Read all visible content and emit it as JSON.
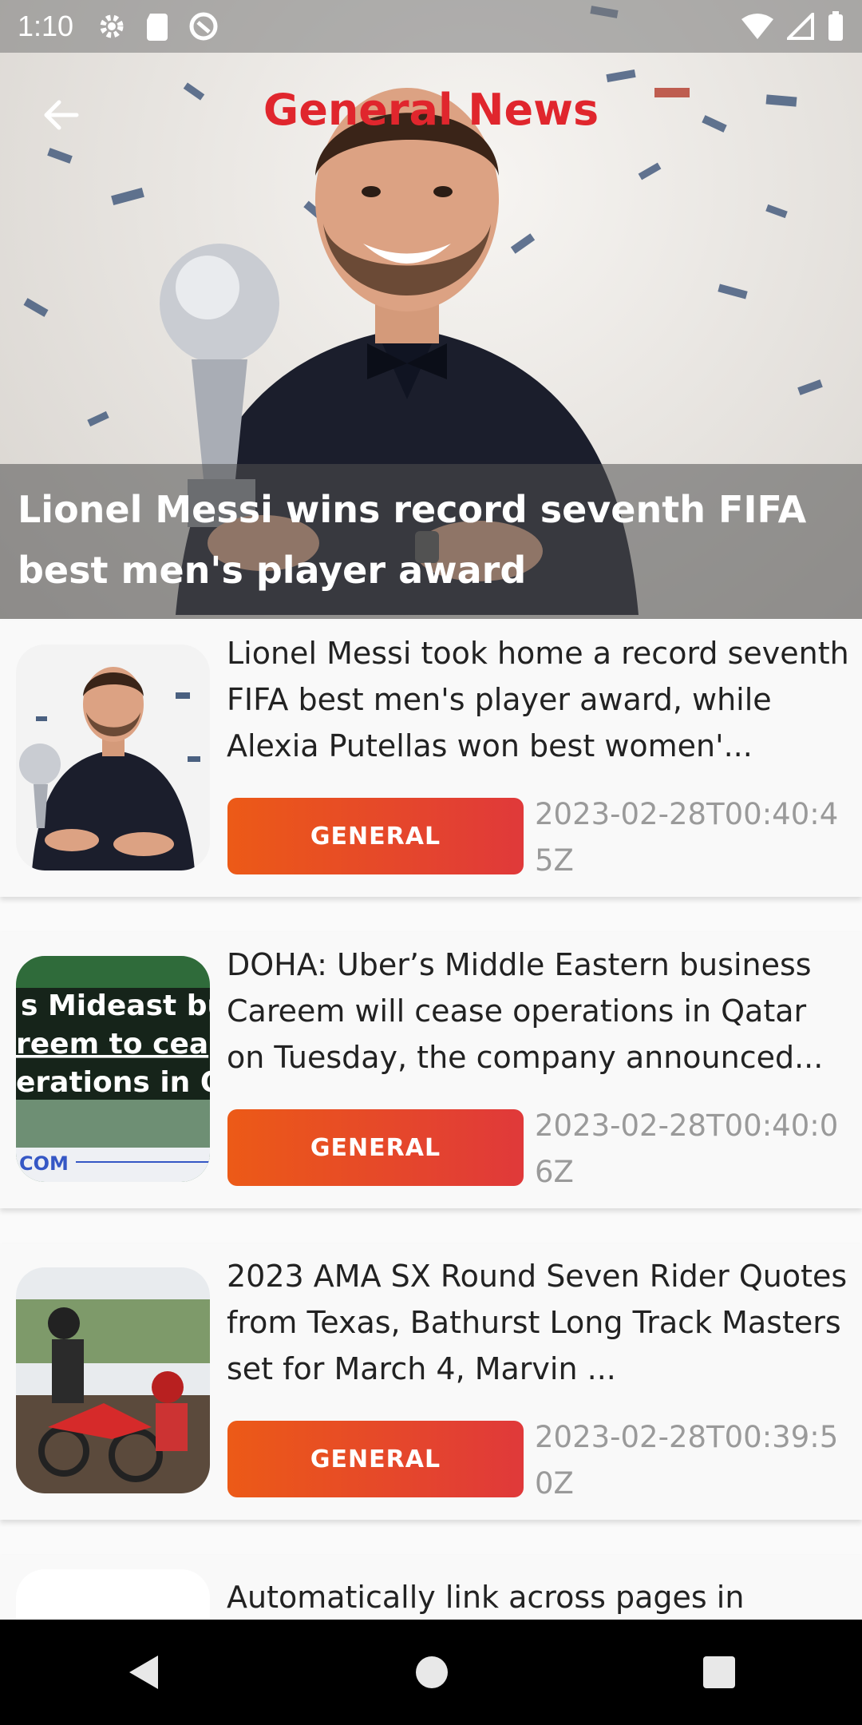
{
  "status_bar": {
    "time": "1:10"
  },
  "header": {
    "title": "General News"
  },
  "hero": {
    "headline": "Lionel Messi wins record seventh FIFA best men's player award"
  },
  "articles": [
    {
      "summary": "Lionel Messi took home a record seventh FIFA best men's player award, while Alexia Putellas won best women'...",
      "category": "GENERAL",
      "date": "2023-02-28T00:40:45Z",
      "thumb": "messi-photo"
    },
    {
      "summary": "DOHA: Uber’s Middle Eastern business Careem will cease operations in Qatar on Tuesday, the company announced...",
      "category": "GENERAL",
      "date": "2023-02-28T00:40:06Z",
      "thumb": "careem-headline-photo",
      "thumb_text": [
        "s Mideast bu",
        "reem to cea",
        "erations in Qa",
        "COM"
      ]
    },
    {
      "summary": "2023 AMA SX Round Seven Rider Quotes from Texas, Bathurst Long Track Masters set for March 4, Marvin ...",
      "category": "GENERAL",
      "date": "2023-02-28T00:39:50Z",
      "thumb": "motocross-photo"
    },
    {
      "summary": "Automatically link across pages in",
      "category": "",
      "date": "",
      "thumb": "logo-photo"
    }
  ],
  "colors": {
    "title": "#e0262d",
    "button_start": "#ec5a17",
    "button_end": "#e0393a"
  }
}
